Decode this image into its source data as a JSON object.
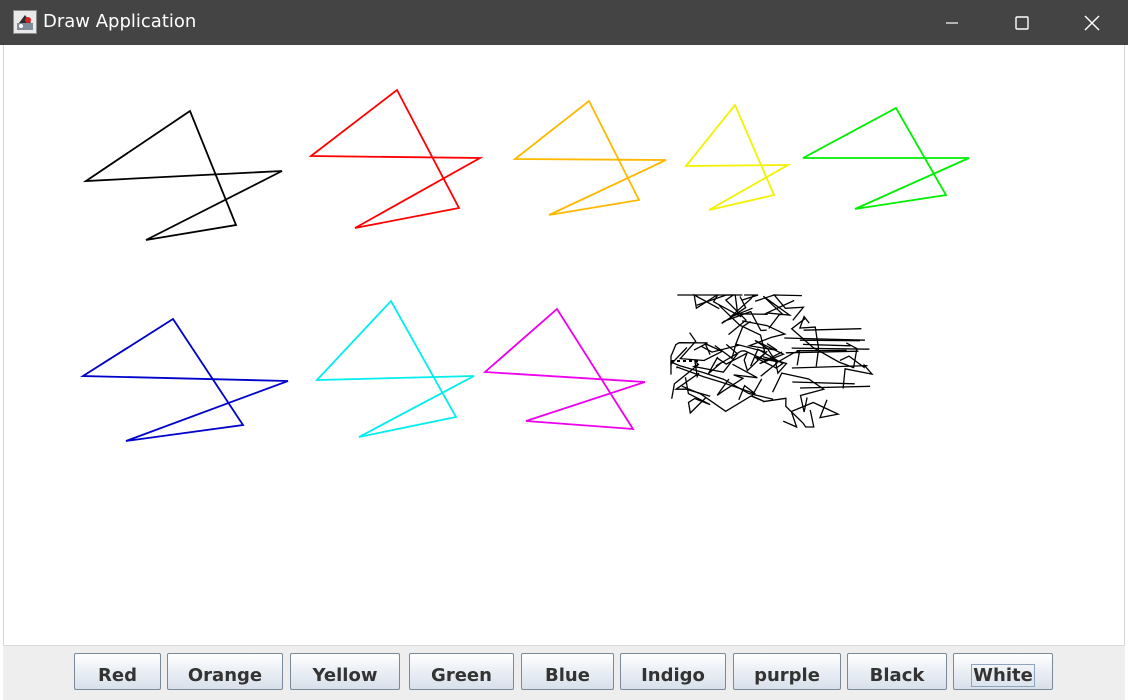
{
  "window": {
    "title": "Draw Application"
  },
  "canvas": {
    "background": "#ffffff",
    "stars": [
      {
        "color": "#000000"
      },
      {
        "color": "#ff0000"
      },
      {
        "color": "#ffb800"
      },
      {
        "color": "#f2f200"
      },
      {
        "color": "#00ee00"
      },
      {
        "color": "#0000cc"
      },
      {
        "color": "#00eeee"
      },
      {
        "color": "#ee00ee"
      }
    ],
    "scribble_color": "#000000"
  },
  "buttons": [
    {
      "label": "Red"
    },
    {
      "label": "Orange"
    },
    {
      "label": "Yellow"
    },
    {
      "label": "Green"
    },
    {
      "label": "Blue"
    },
    {
      "label": "Indigo"
    },
    {
      "label": "purple"
    },
    {
      "label": "Black"
    },
    {
      "label": "White"
    }
  ],
  "focused_button": "White"
}
